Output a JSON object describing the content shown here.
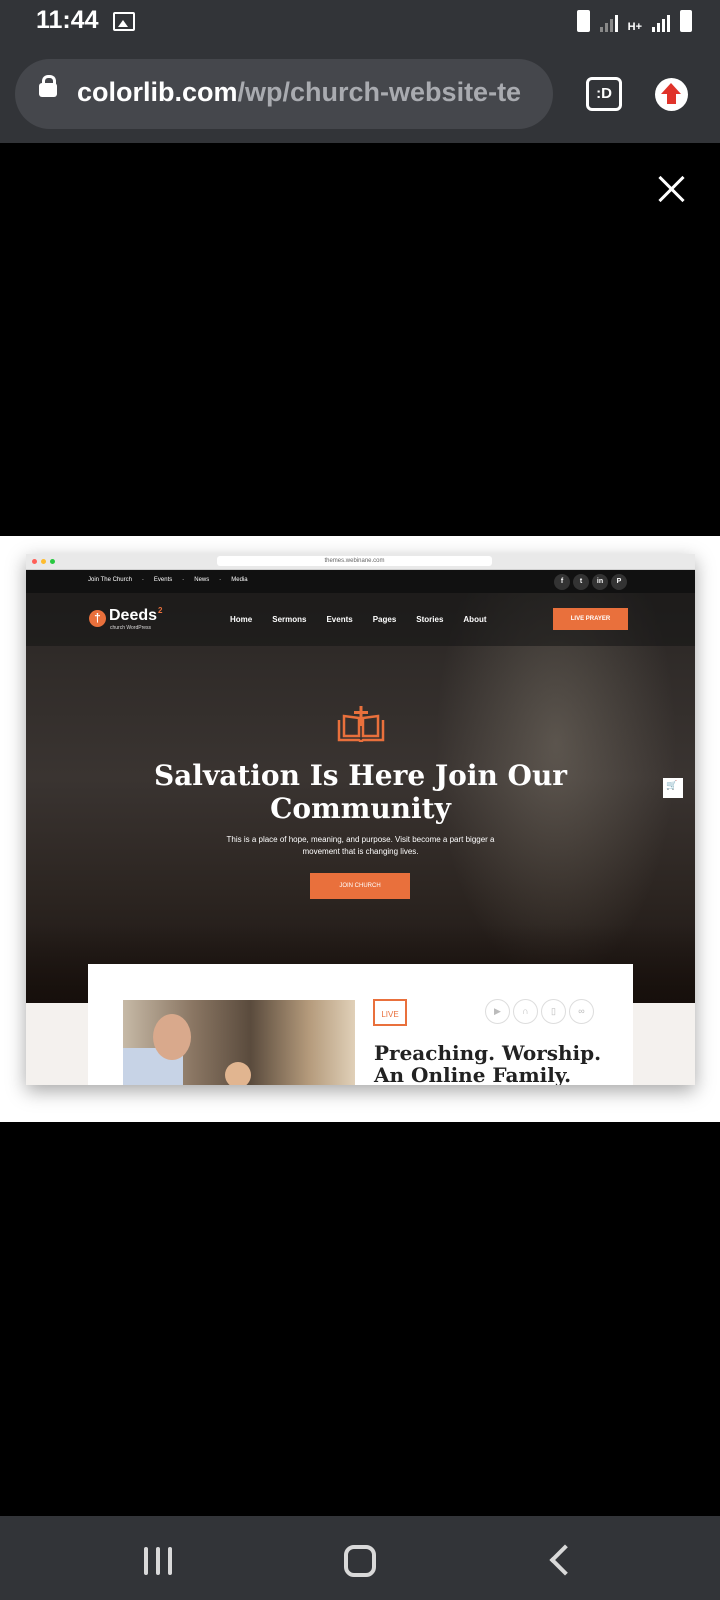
{
  "status_bar": {
    "time": "11:44",
    "network_type": "H+"
  },
  "browser": {
    "url_domain": "colorlib.com",
    "url_path": "/wp/church-website-te",
    "tab_button": ":D"
  },
  "screenshot": {
    "mac_url": "themes.webinane.com",
    "top_links": [
      "Join The Church",
      "Events",
      "News",
      "Media"
    ],
    "social": [
      "f",
      "t",
      "in",
      "P"
    ],
    "logo_name": "Deeds",
    "logo_sup": "2",
    "logo_sub": "church WordPress",
    "menu": [
      "Home",
      "Sermons",
      "Events",
      "Pages",
      "Stories",
      "About"
    ],
    "live_prayer": "LIVE PRAYER",
    "hero_title": "Salvation Is Here Join Our Community",
    "hero_sub": "This is a place of hope, meaning, and purpose. Visit become a part bigger a movement that is changing lives.",
    "join_button": "JOIN CHURCH",
    "live_tag": "LIVE",
    "card_title_1": "Preaching. Worship.",
    "card_title_2": "An Online Family.",
    "card_icons": [
      "youtube-icon",
      "headphones-icon",
      "document-icon",
      "link-icon"
    ]
  },
  "colors": {
    "accent": "#e9703c",
    "chrome": "#323438",
    "pill": "#45474c"
  }
}
